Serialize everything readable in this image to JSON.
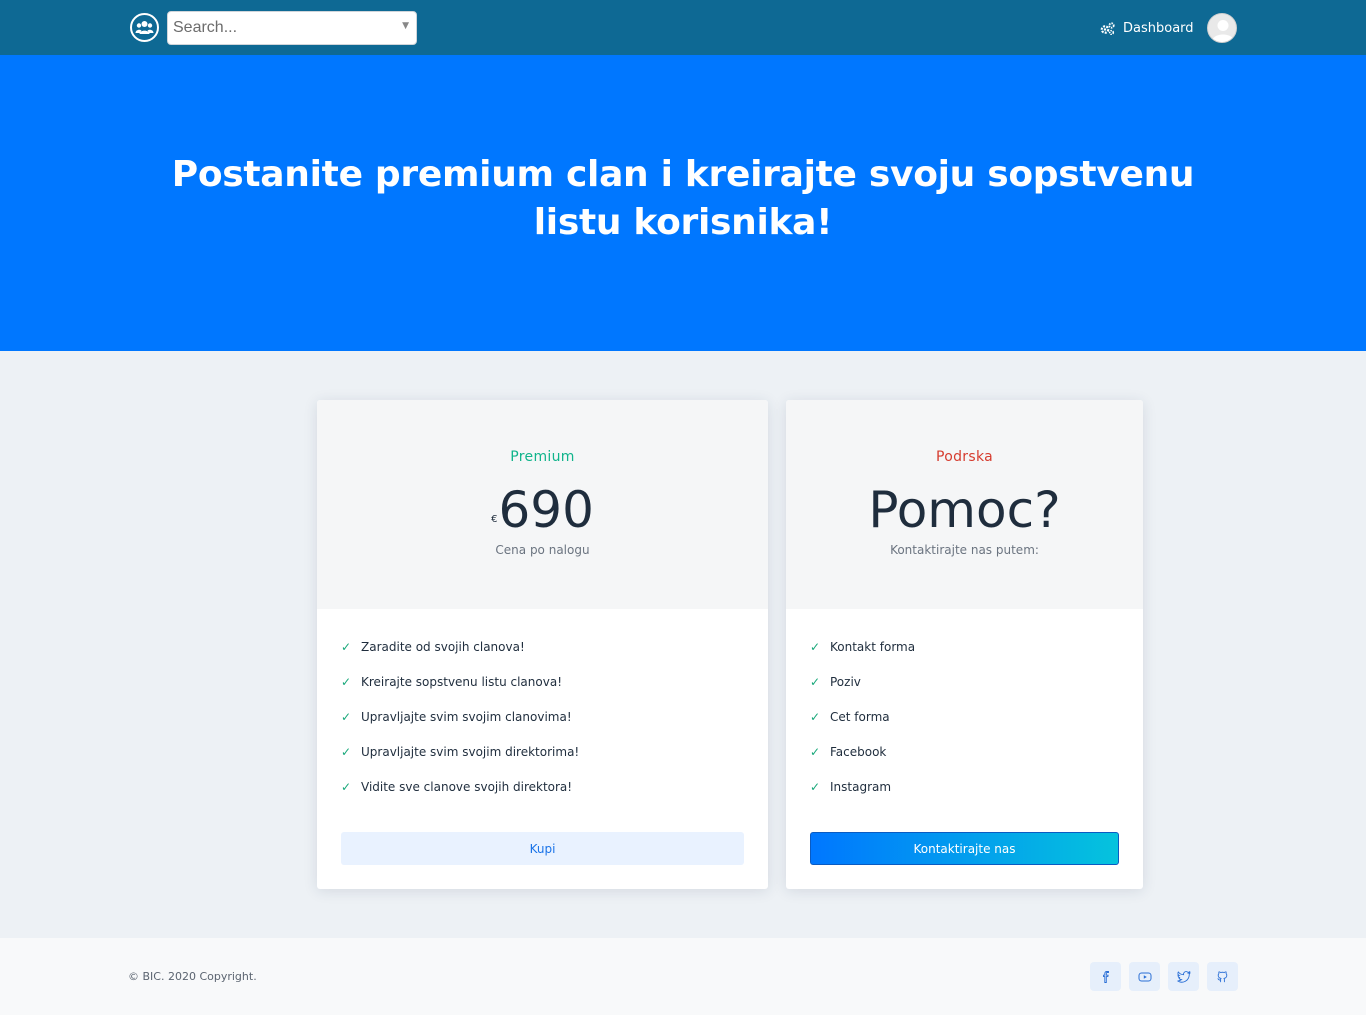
{
  "navbar": {
    "search_placeholder": "Search...",
    "dashboard_label": "Dashboard"
  },
  "hero": {
    "title": "Postanite premium clan i kreirajte svoju sopstvenu listu korisnika!"
  },
  "plans": [
    {
      "name": "Premium",
      "currency": "€",
      "price": "690",
      "subtitle": "Cena po nalogu",
      "features": [
        "Zaradite od svojih clanova!",
        "Kreirajte sopstvenu listu clanova!",
        "Upravljajte svim svojim clanovima!",
        "Upravljajte svim svojim direktorima!",
        "Vidite sve clanove svojih direktora!"
      ],
      "button_label": "Kupi"
    },
    {
      "name": "Podrska",
      "headline": "Pomoc?",
      "subtitle": "Kontaktirajte nas putem:",
      "features": [
        "Kontakt forma",
        "Poziv",
        "Cet forma",
        "Facebook",
        "Instagram"
      ],
      "button_label": "Kontaktirajte nas"
    }
  ],
  "footer": {
    "copyright": "© BIC. 2020 Copyright.",
    "social_icons": [
      "facebook-icon",
      "youtube-icon",
      "twitter-icon",
      "github-icon"
    ]
  },
  "colors": {
    "navbar": "#0e6994",
    "hero": "#0077ff",
    "premium": "#10b48b",
    "support": "#d63c2f",
    "check": "#18a87a"
  }
}
